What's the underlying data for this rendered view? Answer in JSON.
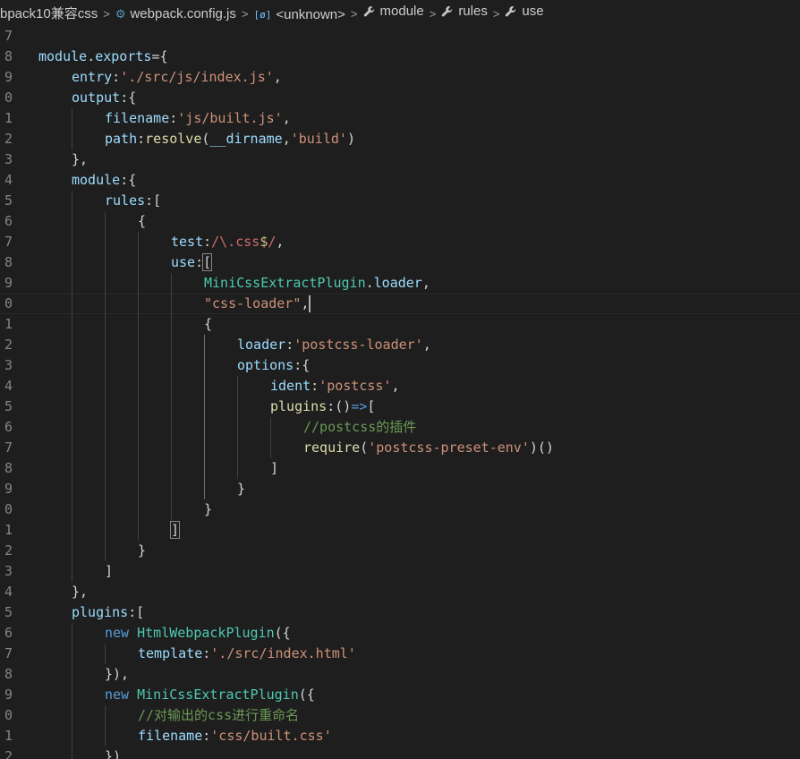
{
  "breadcrumb": {
    "items": [
      {
        "label": "bpack10兼容css",
        "icon": ""
      },
      {
        "label": "webpack.config.js",
        "icon": "config-file-icon"
      },
      {
        "label": "<unknown>",
        "icon": "symbol-variable-icon"
      },
      {
        "label": "module",
        "icon": "wrench-icon"
      },
      {
        "label": "rules",
        "icon": "wrench-icon"
      },
      {
        "label": "use",
        "icon": "wrench-icon"
      }
    ],
    "separator": ">"
  },
  "editor": {
    "current_line": "0",
    "lines": [
      {
        "num": "7",
        "indent": 0,
        "tokens": []
      },
      {
        "num": "8",
        "indent": 0,
        "tokens": [
          [
            "module",
            "t-var"
          ],
          [
            ".",
            "t-plain"
          ],
          [
            "exports",
            "t-var"
          ],
          [
            "={",
            "t-plain"
          ]
        ]
      },
      {
        "num": "9",
        "indent": 1,
        "tokens": [
          [
            "entry",
            "t-var"
          ],
          [
            ":",
            "t-plain"
          ],
          [
            "'./src/js/index.js'",
            "t-str"
          ],
          [
            ",",
            "t-plain"
          ]
        ]
      },
      {
        "num": "0",
        "indent": 1,
        "tokens": [
          [
            "output",
            "t-var"
          ],
          [
            ":{",
            "t-plain"
          ]
        ]
      },
      {
        "num": "1",
        "indent": 2,
        "tokens": [
          [
            "filename",
            "t-var"
          ],
          [
            ":",
            "t-plain"
          ],
          [
            "'js/built.js'",
            "t-str"
          ],
          [
            ",",
            "t-plain"
          ]
        ]
      },
      {
        "num": "2",
        "indent": 2,
        "tokens": [
          [
            "path",
            "t-var"
          ],
          [
            ":",
            "t-plain"
          ],
          [
            "resolve",
            "t-fn"
          ],
          [
            "(",
            "t-plain"
          ],
          [
            "__dirname",
            "t-var"
          ],
          [
            ",",
            "t-plain"
          ],
          [
            "'build'",
            "t-str"
          ],
          [
            ")",
            "t-plain"
          ]
        ]
      },
      {
        "num": "3",
        "indent": 1,
        "tokens": [
          [
            "},",
            "t-plain"
          ]
        ]
      },
      {
        "num": "4",
        "indent": 1,
        "tokens": [
          [
            "module",
            "t-var"
          ],
          [
            ":{",
            "t-plain"
          ]
        ]
      },
      {
        "num": "5",
        "indent": 2,
        "tokens": [
          [
            "rules",
            "t-var"
          ],
          [
            ":[",
            "t-plain"
          ]
        ]
      },
      {
        "num": "6",
        "indent": 3,
        "tokens": [
          [
            "{",
            "t-plain"
          ]
        ]
      },
      {
        "num": "7",
        "indent": 4,
        "tokens": [
          [
            "test",
            "t-var"
          ],
          [
            ":",
            "t-plain"
          ],
          [
            "/\\.",
            "t-rx"
          ],
          [
            "css",
            "t-rx"
          ],
          [
            "$",
            "t-esc"
          ],
          [
            "/",
            "t-rx"
          ],
          [
            ",",
            "t-plain"
          ]
        ]
      },
      {
        "num": "8",
        "indent": 4,
        "tokens": [
          [
            "use",
            "t-var"
          ],
          [
            ":",
            "t-plain"
          ],
          [
            "[",
            "t-plain",
            "bm"
          ]
        ]
      },
      {
        "num": "9",
        "indent": 5,
        "tokens": [
          [
            "MiniCssExtractPlugin",
            "t-cls"
          ],
          [
            ".",
            "t-plain"
          ],
          [
            "loader",
            "t-var"
          ],
          [
            ",",
            "t-plain"
          ]
        ]
      },
      {
        "num": "0",
        "indent": 5,
        "tokens": [
          [
            "\"css-loader\"",
            "t-str"
          ],
          [
            ",",
            "t-plain"
          ],
          [
            "|",
            "cursor"
          ]
        ]
      },
      {
        "num": "1",
        "indent": 5,
        "tokens": [
          [
            "{",
            "t-plain"
          ]
        ]
      },
      {
        "num": "2",
        "indent": 6,
        "tokens": [
          [
            "loader",
            "t-var"
          ],
          [
            ":",
            "t-plain"
          ],
          [
            "'postcss-loader'",
            "t-str"
          ],
          [
            ",",
            "t-plain"
          ]
        ]
      },
      {
        "num": "3",
        "indent": 6,
        "tokens": [
          [
            "options",
            "t-var"
          ],
          [
            ":{",
            "t-plain"
          ]
        ]
      },
      {
        "num": "4",
        "indent": 7,
        "tokens": [
          [
            "ident",
            "t-var"
          ],
          [
            ":",
            "t-plain"
          ],
          [
            "'postcss'",
            "t-str"
          ],
          [
            ",",
            "t-plain"
          ]
        ]
      },
      {
        "num": "5",
        "indent": 7,
        "tokens": [
          [
            "plugins",
            "t-fn"
          ],
          [
            ":()",
            "t-plain"
          ],
          [
            "=>",
            "t-kw"
          ],
          [
            "[",
            "t-plain"
          ]
        ]
      },
      {
        "num": "6",
        "indent": 8,
        "tokens": [
          [
            "//postcss的插件",
            "t-com"
          ]
        ]
      },
      {
        "num": "7",
        "indent": 8,
        "tokens": [
          [
            "require",
            "t-fn"
          ],
          [
            "(",
            "t-plain"
          ],
          [
            "'postcss-preset-env'",
            "t-str"
          ],
          [
            ")()",
            "t-plain"
          ]
        ]
      },
      {
        "num": "8",
        "indent": 7,
        "tokens": [
          [
            "]",
            "t-plain"
          ]
        ]
      },
      {
        "num": "9",
        "indent": 6,
        "tokens": [
          [
            "}",
            "t-plain"
          ]
        ]
      },
      {
        "num": "0",
        "indent": 5,
        "tokens": [
          [
            "}",
            "t-plain"
          ]
        ]
      },
      {
        "num": "1",
        "indent": 4,
        "tokens": [
          [
            "]",
            "t-plain",
            "bm"
          ]
        ]
      },
      {
        "num": "2",
        "indent": 3,
        "tokens": [
          [
            "}",
            "t-plain"
          ]
        ]
      },
      {
        "num": "3",
        "indent": 2,
        "tokens": [
          [
            "]",
            "t-plain"
          ]
        ]
      },
      {
        "num": "4",
        "indent": 1,
        "tokens": [
          [
            "},",
            "t-plain"
          ]
        ]
      },
      {
        "num": "5",
        "indent": 1,
        "tokens": [
          [
            "plugins",
            "t-var"
          ],
          [
            ":[",
            "t-plain"
          ]
        ]
      },
      {
        "num": "6",
        "indent": 2,
        "tokens": [
          [
            "new",
            "t-kw"
          ],
          [
            " ",
            "t-plain"
          ],
          [
            "HtmlWebpackPlugin",
            "t-cls"
          ],
          [
            "({",
            "t-plain"
          ]
        ]
      },
      {
        "num": "7",
        "indent": 3,
        "tokens": [
          [
            "template",
            "t-var"
          ],
          [
            ":",
            "t-plain"
          ],
          [
            "'./src/index.html'",
            "t-str"
          ]
        ]
      },
      {
        "num": "8",
        "indent": 2,
        "tokens": [
          [
            "}),",
            "t-plain"
          ]
        ]
      },
      {
        "num": "9",
        "indent": 2,
        "tokens": [
          [
            "new",
            "t-kw"
          ],
          [
            " ",
            "t-plain"
          ],
          [
            "MiniCssExtractPlugin",
            "t-cls"
          ],
          [
            "({",
            "t-plain"
          ]
        ]
      },
      {
        "num": "0",
        "indent": 3,
        "tokens": [
          [
            "//对输出的css进行重命名",
            "t-com"
          ]
        ]
      },
      {
        "num": "1",
        "indent": 3,
        "tokens": [
          [
            "filename",
            "t-var"
          ],
          [
            ":",
            "t-plain"
          ],
          [
            "'css/built.css'",
            "t-str"
          ]
        ]
      },
      {
        "num": "2",
        "indent": 2,
        "tokens": [
          [
            "})",
            "t-plain"
          ]
        ]
      }
    ]
  }
}
